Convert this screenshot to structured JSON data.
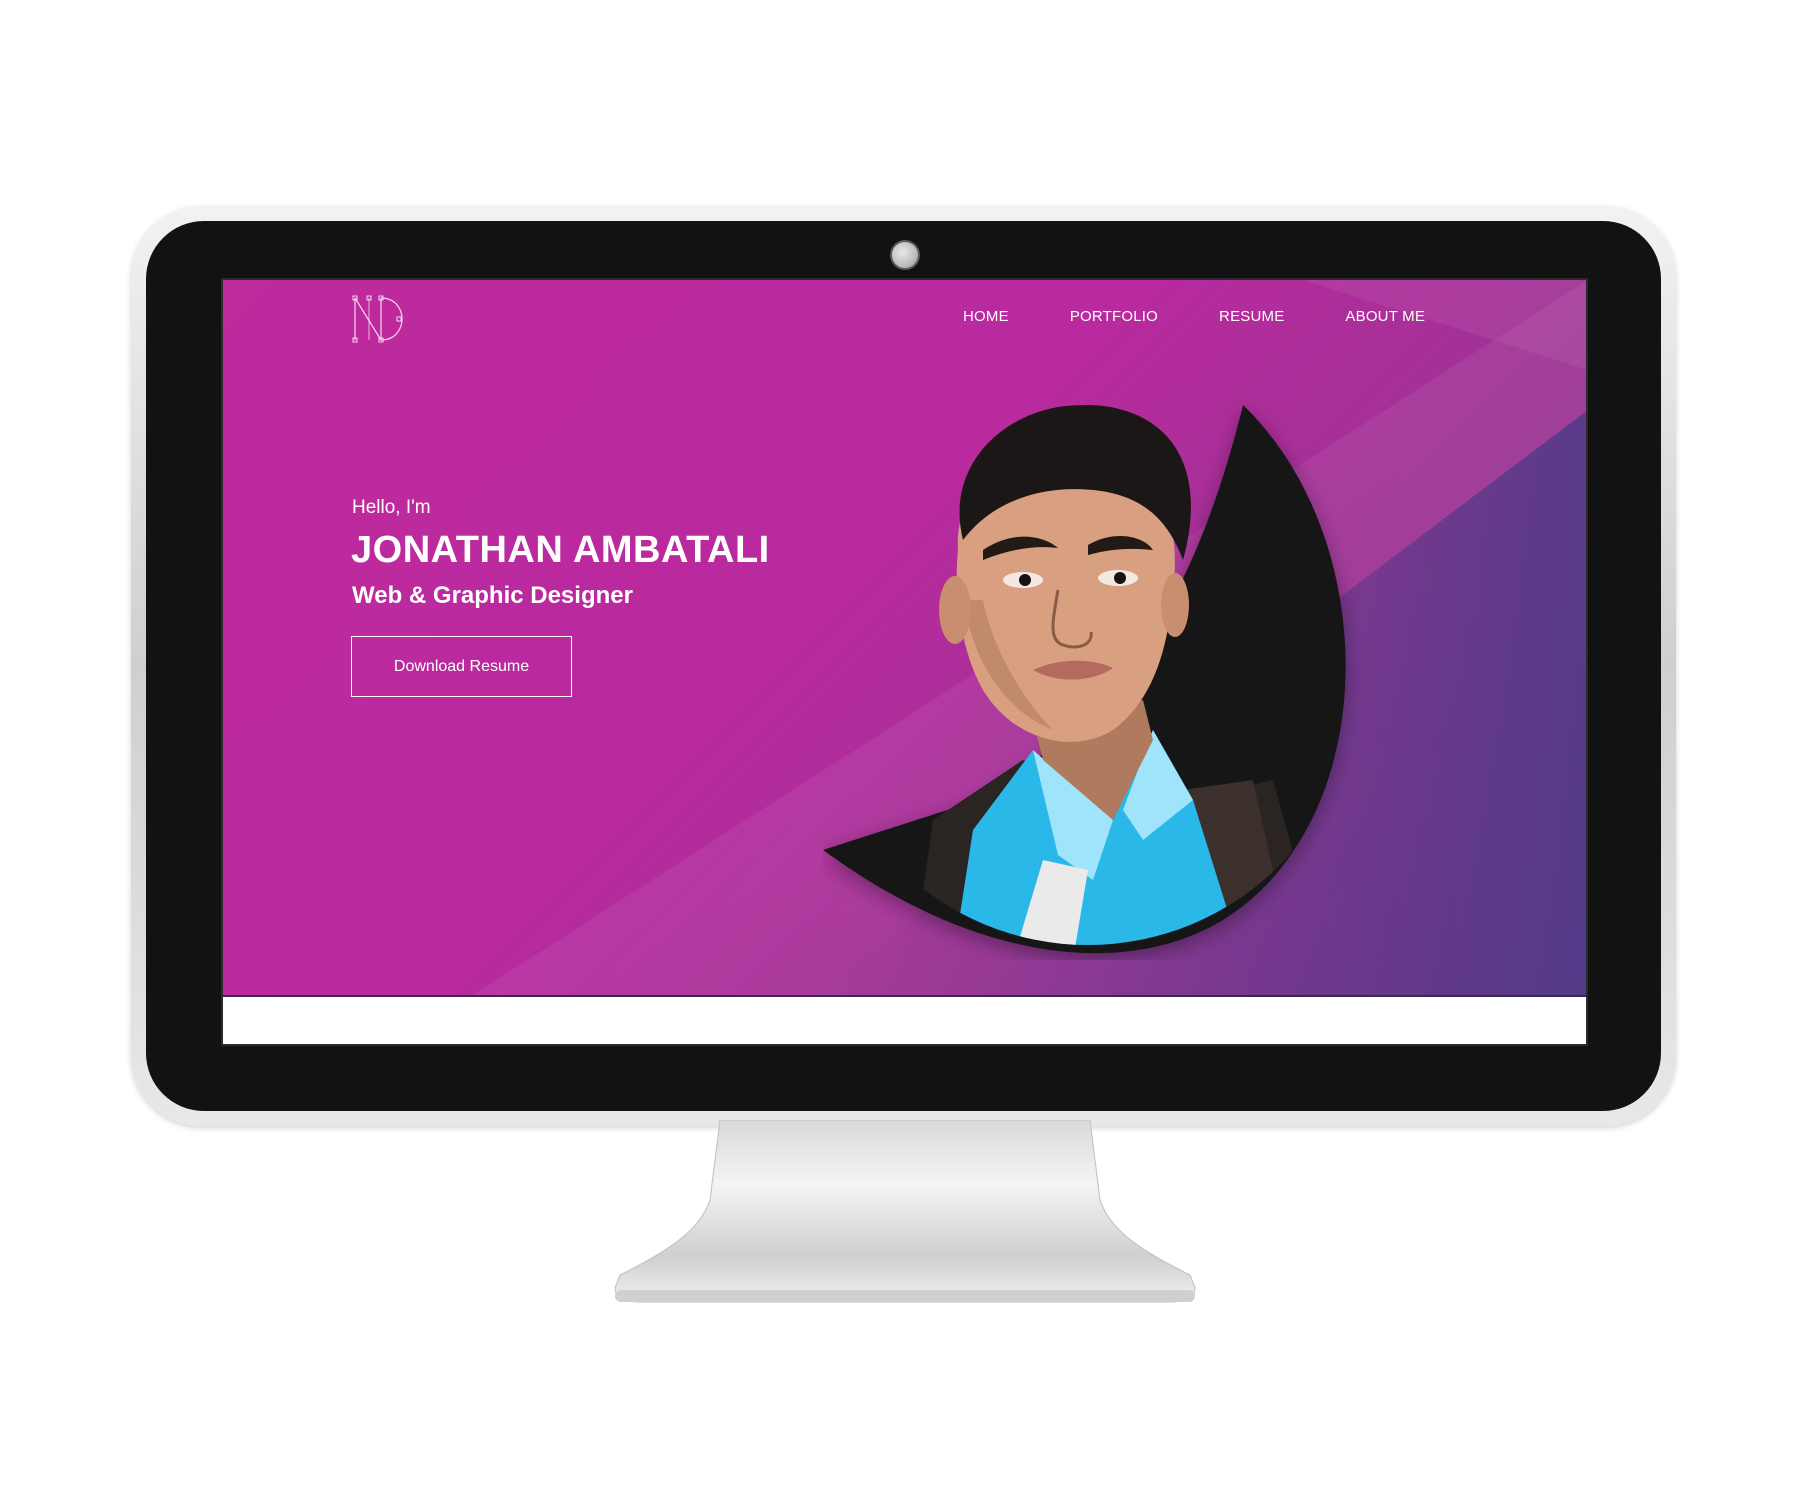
{
  "site": {
    "logo_label": "ND"
  },
  "nav": {
    "items": [
      {
        "label": "HOME"
      },
      {
        "label": "PORTFOLIO"
      },
      {
        "label": "RESUME"
      },
      {
        "label": "ABOUT ME"
      }
    ]
  },
  "hero": {
    "greeting": "Hello, I'm",
    "name": "JONATHAN AMBATALI",
    "role": "Web & Graphic Designer",
    "cta_label": "Download Resume"
  },
  "colors": {
    "hero_magenta": "#bf2a9d",
    "hero_purple": "#6b3a8c",
    "bezel": "#121212",
    "shirt_blue": "#29b8e8"
  },
  "icons": {
    "logo": "nd-monogram-icon",
    "webcam": "webcam-icon"
  }
}
